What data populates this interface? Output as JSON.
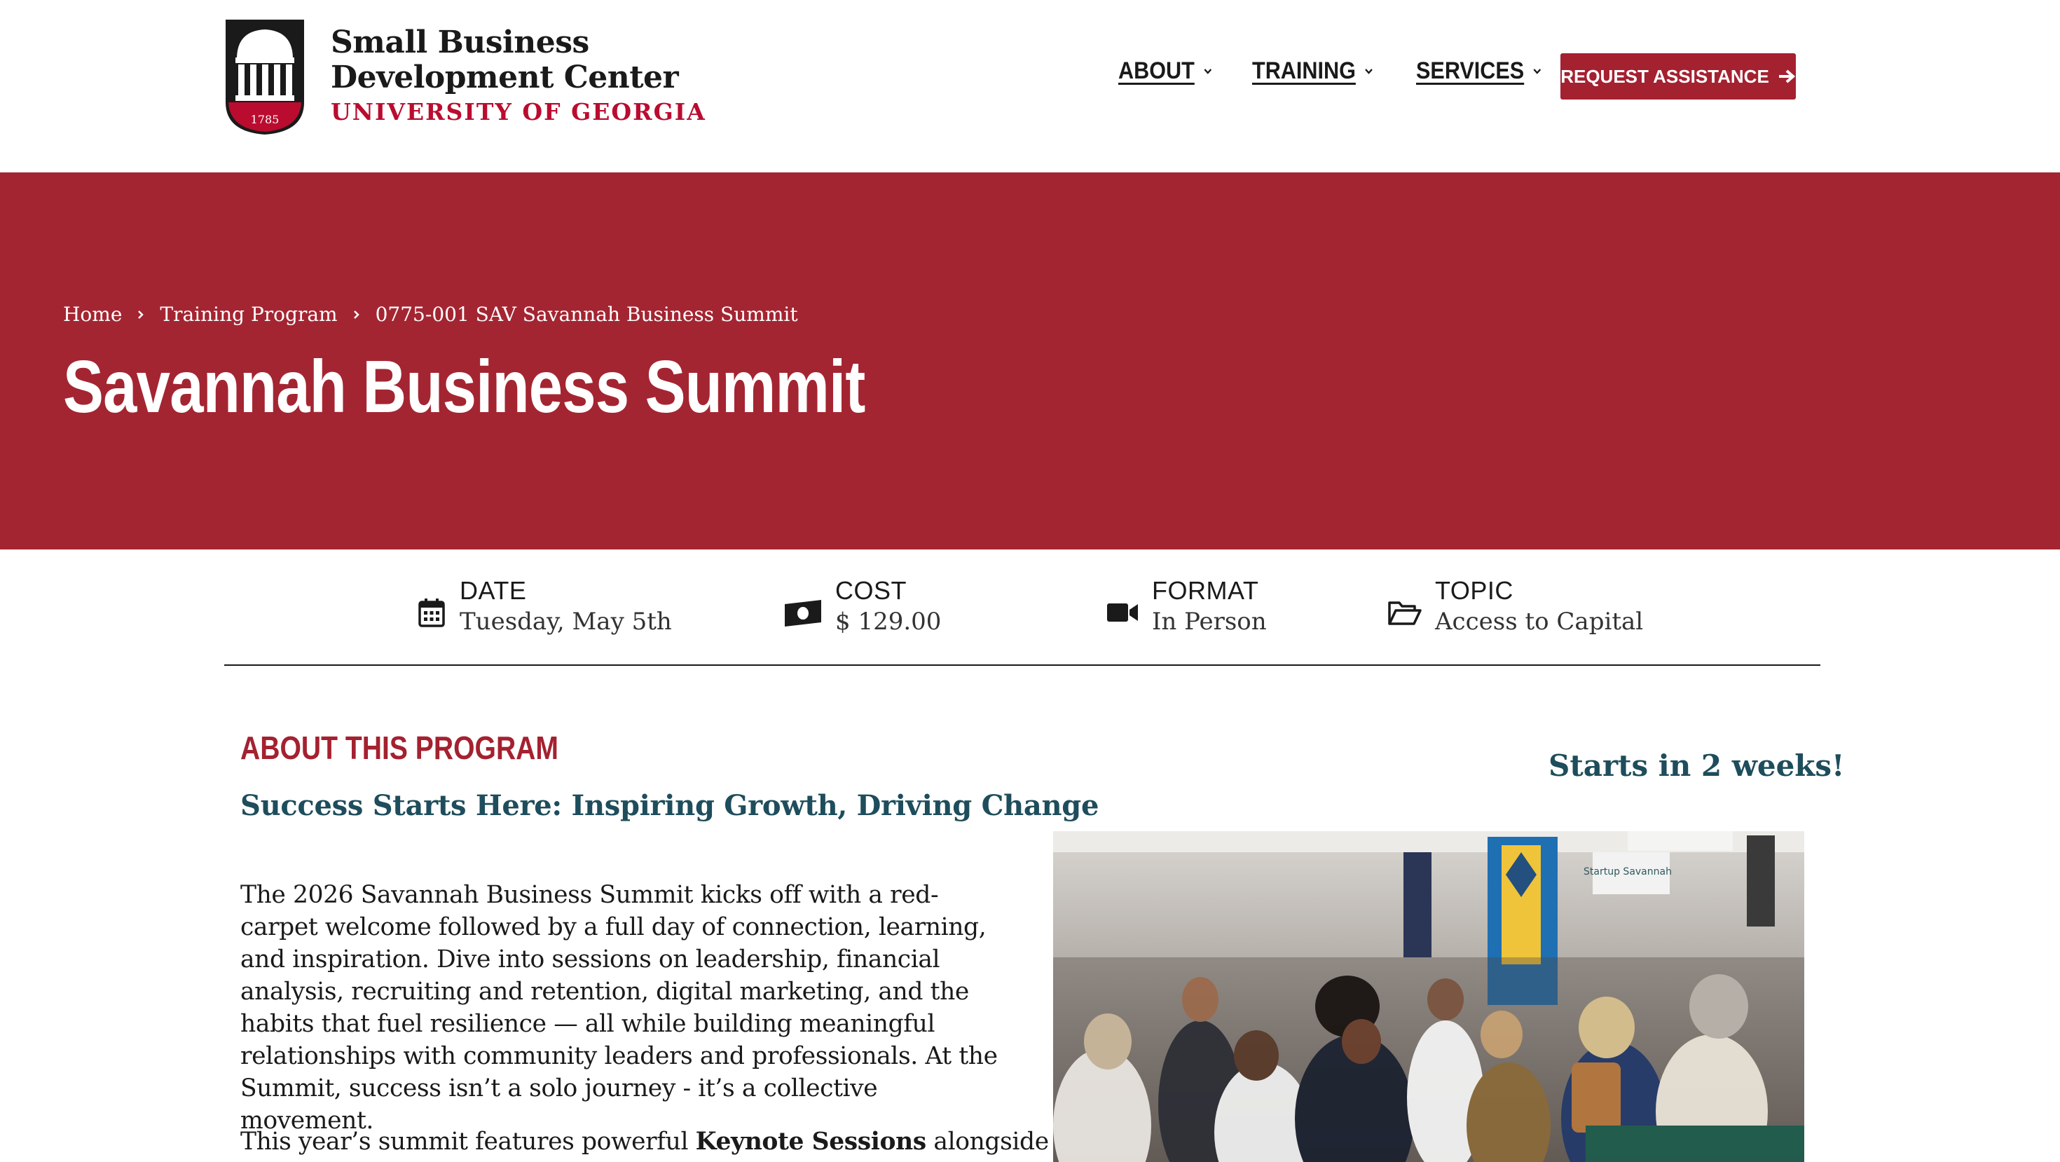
{
  "header": {
    "logo": {
      "line1": "Small Business",
      "line2": "Development Center",
      "line3": "UNIVERSITY OF GEORGIA",
      "year": "1785"
    },
    "nav": [
      {
        "label": "ABOUT"
      },
      {
        "label": "TRAINING"
      },
      {
        "label": "SERVICES"
      }
    ],
    "request_button": "REQUEST ASSISTANCE"
  },
  "breadcrumb": [
    "Home",
    "Training Program",
    "0775-001 SAV Savannah Business Summit"
  ],
  "page_title": "Savannah Business Summit",
  "info": [
    {
      "label": "DATE",
      "value": "Tuesday, May 5th",
      "icon": "calendar-icon"
    },
    {
      "label": "COST",
      "value": "$ 129.00",
      "icon": "money-icon"
    },
    {
      "label": "FORMAT",
      "value": "In Person",
      "icon": "video-camera-icon"
    },
    {
      "label": "TOPIC",
      "value": "Access to Capital",
      "icon": "folder-open-icon"
    }
  ],
  "content": {
    "heading": "ABOUT THIS PROGRAM",
    "subheading": "Success Starts Here: Inspiring Growth, Driving Change",
    "paragraph1": "The 2026 Savannah Business Summit kicks off with a red-carpet welcome followed by a full day of connection, learning, and inspiration. Dive into sessions on leadership, financial analysis, recruiting and retention, digital marketing, and the habits that fuel resilience — all while building meaningful relationships with community leaders and professionals. At the Summit, success isn’t a solo journey - it’s a collective movement.",
    "paragraph2_before": "This year’s summit features powerful ",
    "paragraph2_bold": "Keynote Sessions",
    "paragraph2_after": " alongside",
    "starts_in": "Starts in 2 weeks!",
    "photo_signs": {
      "startup": "Startup Savannah"
    }
  },
  "colors": {
    "brand_red": "#a42532",
    "button_red": "#a42130",
    "teal": "#1e4d5c"
  }
}
